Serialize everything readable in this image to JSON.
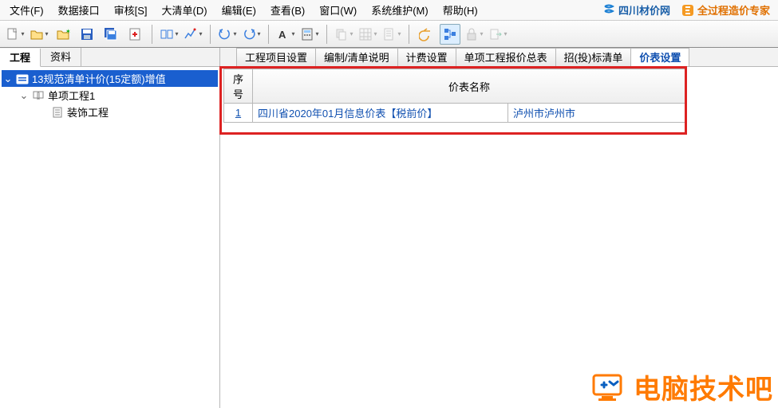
{
  "menu": {
    "file": "文件(F)",
    "data_interface": "数据接口",
    "audit": "审核[S]",
    "big_list": "大清单(D)",
    "edit": "编辑(E)",
    "view": "查看(B)",
    "window": "窗口(W)",
    "maintain": "系统维护(M)",
    "help": "帮助(H)"
  },
  "top_links": {
    "price_net": "四川材价网",
    "full_process": "全过程造价专家"
  },
  "left_tabs": {
    "project": "工程",
    "material": "资料"
  },
  "tree": {
    "root": "13规范清单计价(15定额)增值",
    "child1": "单项工程1",
    "child2": "装饰工程"
  },
  "right_tabs": {
    "t1": "工程项目设置",
    "t2": "编制/清单说明",
    "t3": "计费设置",
    "t4": "单项工程报价总表",
    "t5": "招(投)标清单",
    "t6": "价表设置"
  },
  "grid": {
    "headers": {
      "seq": "序号",
      "name": "价表名称",
      "loc": ""
    },
    "rows": [
      {
        "seq": "1",
        "name": "四川省2020年01月信息价表【税前价】",
        "loc": "泸州市泸州市"
      }
    ]
  },
  "watermark": "电脑技术吧"
}
